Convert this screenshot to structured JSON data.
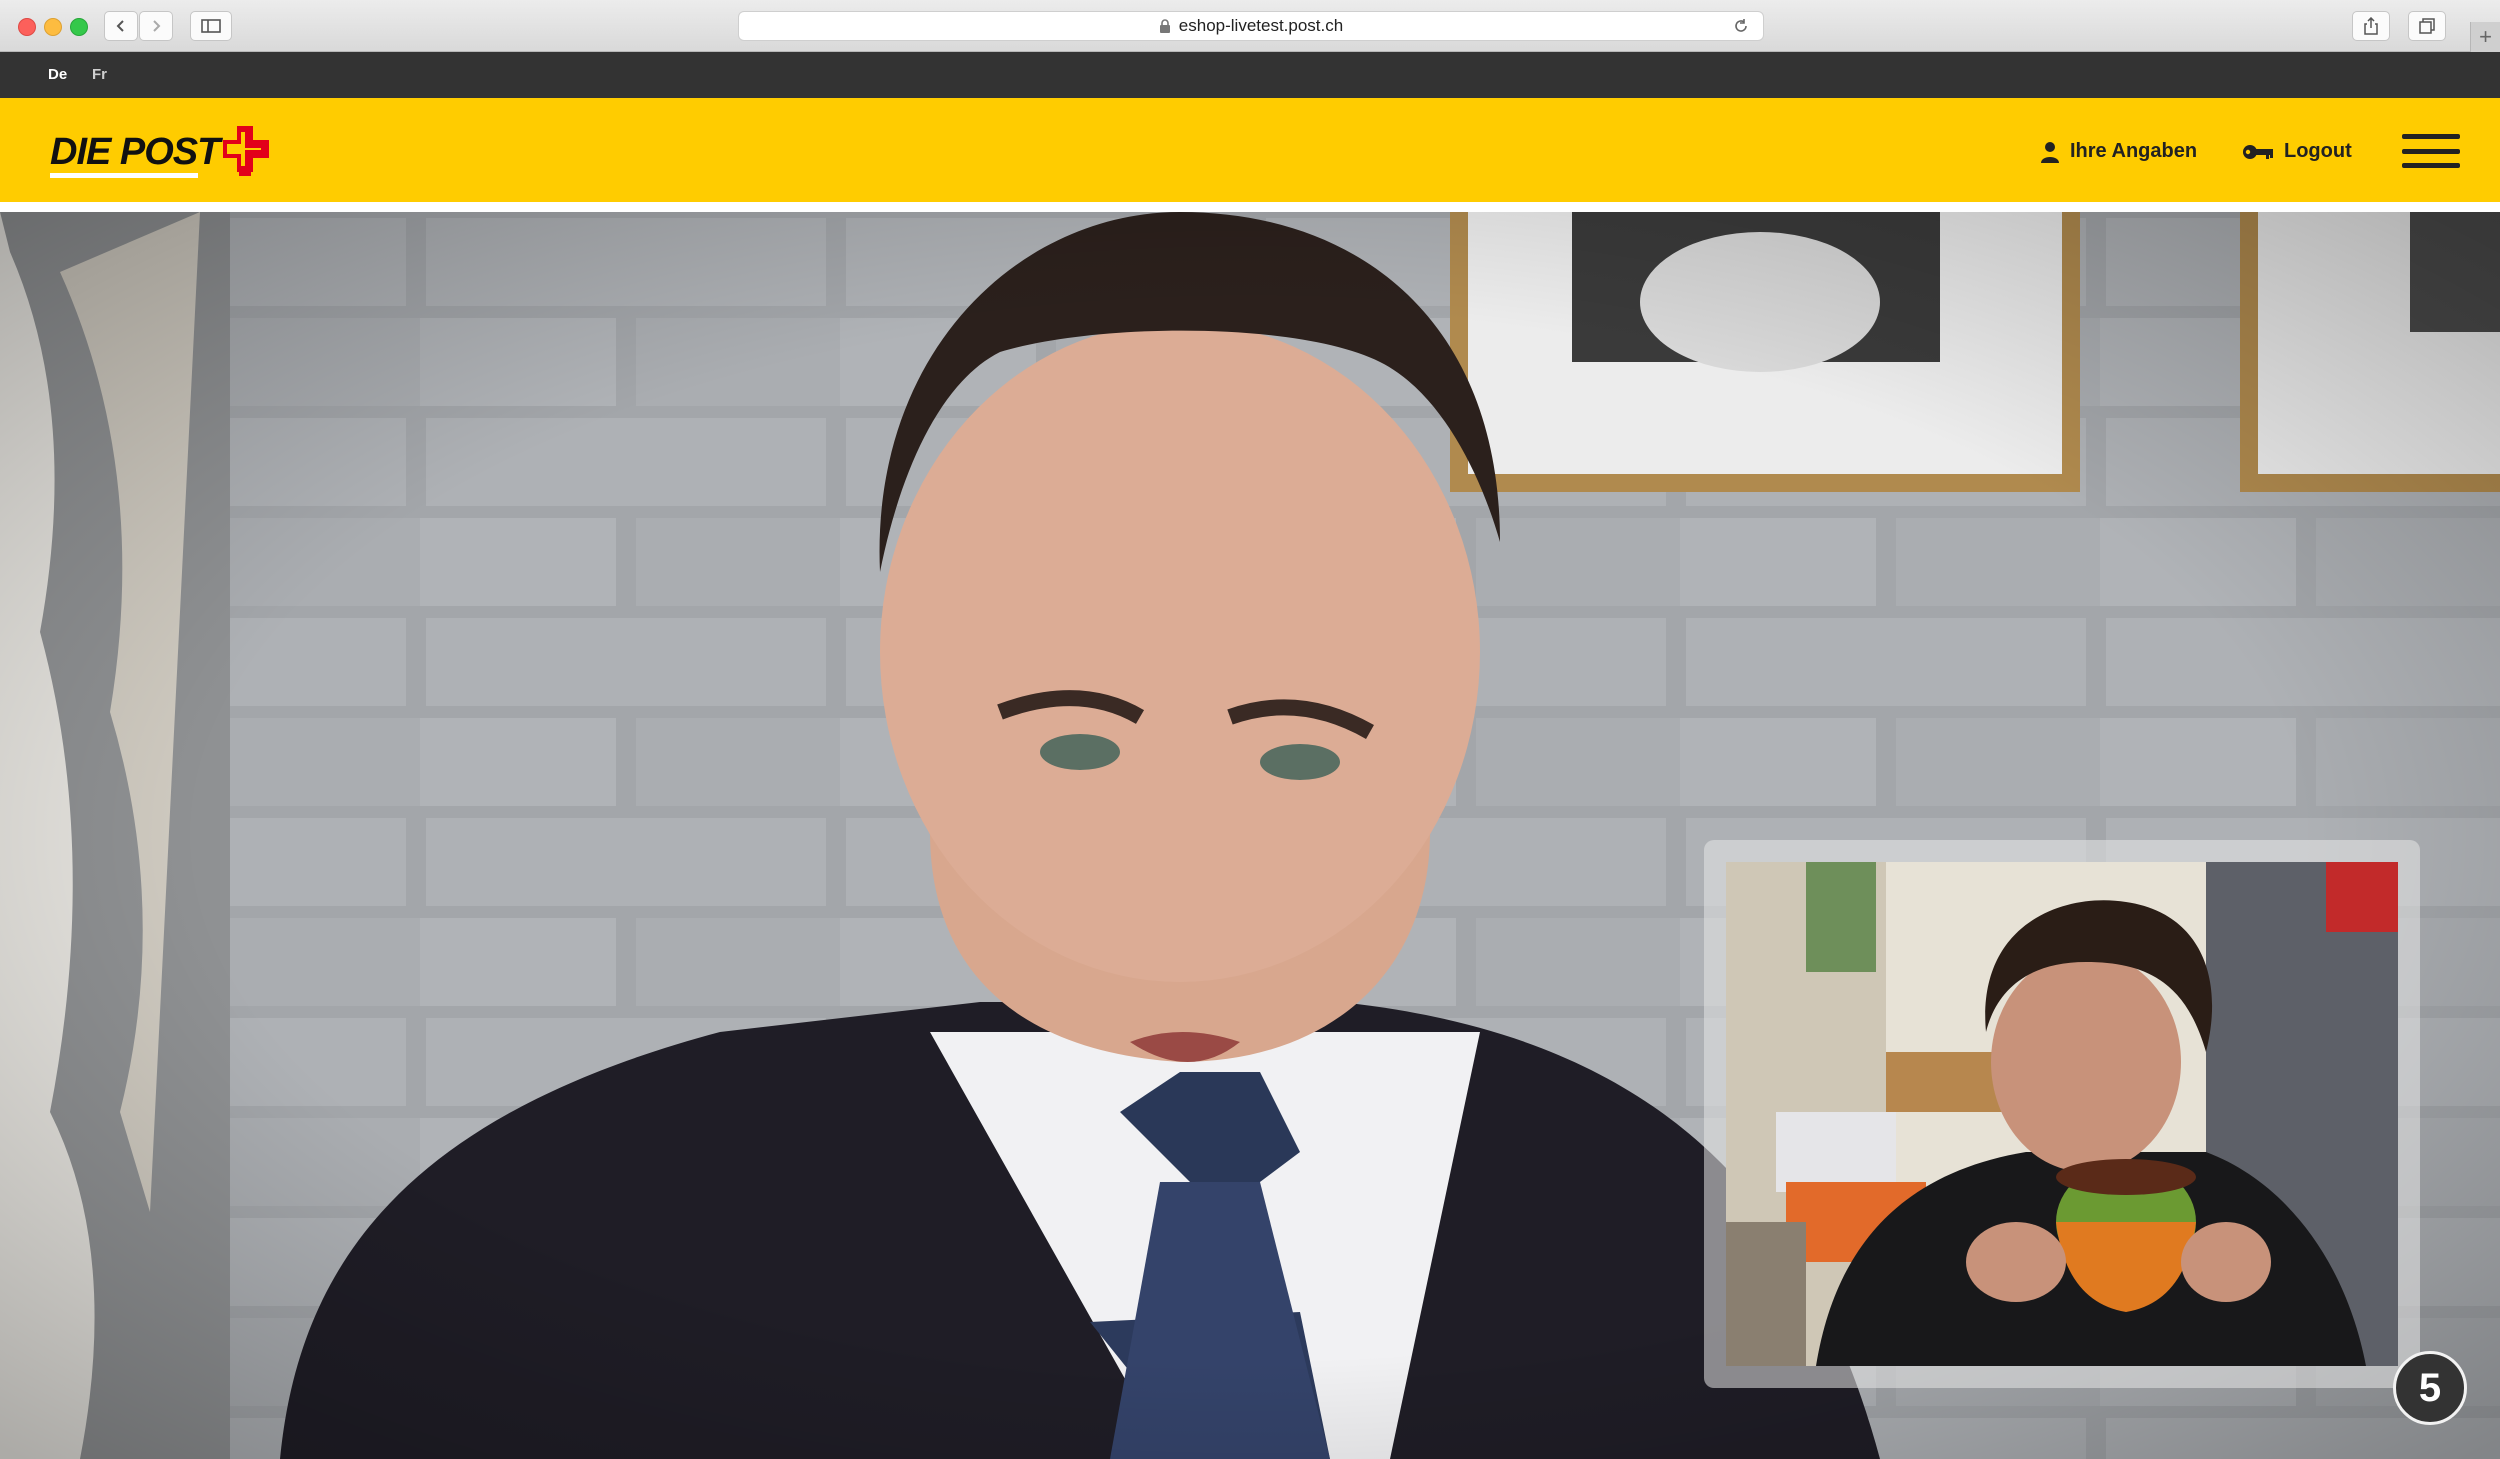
{
  "browser": {
    "url": "eshop-livetest.post.ch"
  },
  "language_bar": {
    "languages": [
      {
        "label": "De",
        "active": true
      },
      {
        "label": "Fr",
        "active": false
      }
    ]
  },
  "header": {
    "logo_text": "DIE POST",
    "links": [
      {
        "label": "Ihre Angaben",
        "icon": "user-icon"
      },
      {
        "label": "Logout",
        "icon": "key-icon"
      }
    ],
    "menu_icon": "hamburger-menu-icon"
  },
  "video": {
    "participant_count": "5"
  },
  "colors": {
    "brand_yellow": "#ffcc00",
    "brand_red": "#e2001a",
    "lang_bar": "#333333"
  }
}
